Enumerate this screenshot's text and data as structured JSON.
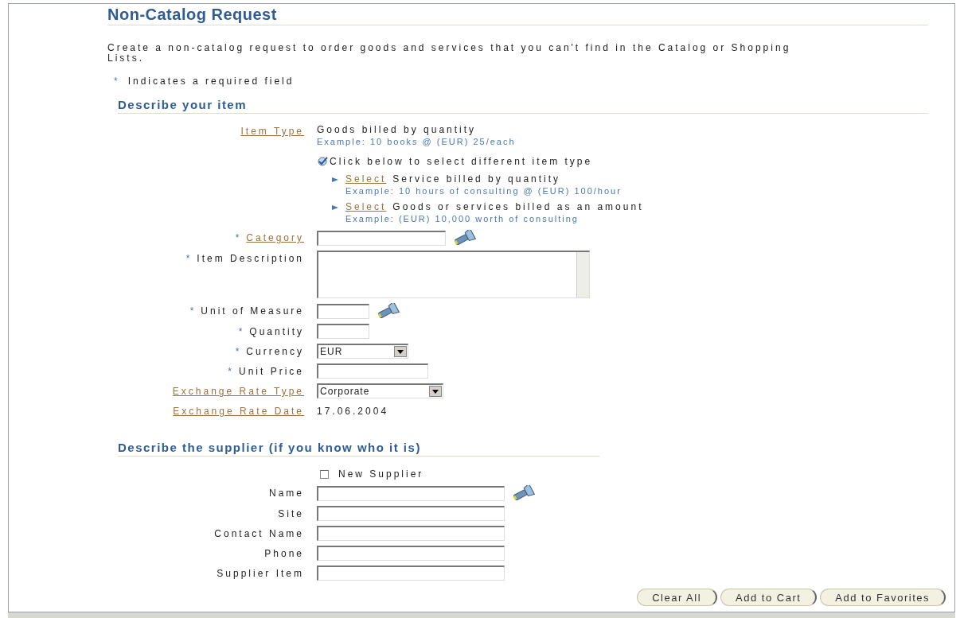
{
  "title": "Non-Catalog Request",
  "intro": "Create a non-catalog request to order goods and services that you can't find in the Catalog or Shopping Lists.",
  "required_note": {
    "mark": "*",
    "text": "Indicates a required field"
  },
  "item_section": {
    "heading": "Describe your item",
    "item_type": {
      "label": "Item Type",
      "value": "Goods billed by quantity",
      "example": "Example: 10 books @ (EUR) 25/each"
    },
    "change_prompt": "Click below to select different item type",
    "options": [
      {
        "link": "Select",
        "text": "Service billed by quantity",
        "example": "Example: 10 hours of consulting @ (EUR) 100/hour"
      },
      {
        "link": "Select",
        "text": "Goods or services billed as an amount",
        "example": "Example: (EUR) 10,000 worth of consulting"
      }
    ],
    "fields": [
      {
        "label": "Category",
        "kind": "lookup",
        "required": true,
        "link": true
      },
      {
        "label": "Item Description",
        "kind": "textarea",
        "required": true,
        "link": false
      },
      {
        "label": "Unit of Measure",
        "kind": "lookup",
        "required": true,
        "link": false
      },
      {
        "label": "Quantity",
        "kind": "text",
        "required": true,
        "link": false
      },
      {
        "label": "Currency",
        "kind": "select",
        "required": true,
        "link": false,
        "value": "EUR"
      },
      {
        "label": "Unit Price",
        "kind": "text",
        "required": true,
        "link": false
      },
      {
        "label": "Exchange Rate Type",
        "kind": "select",
        "required": false,
        "link": true,
        "value": "Corporate"
      },
      {
        "label": "Exchange Rate Date",
        "kind": "static",
        "required": false,
        "link": true,
        "value": "17.06.2004"
      }
    ]
  },
  "supplier_section": {
    "heading": "Describe the supplier (if you know who it is)",
    "new_supplier": {
      "label": "New Supplier",
      "checked": false
    },
    "fields": [
      {
        "label": "Name",
        "kind": "lookup"
      },
      {
        "label": "Site",
        "kind": "text"
      },
      {
        "label": "Contact Name",
        "kind": "text"
      },
      {
        "label": "Phone",
        "kind": "text"
      },
      {
        "label": "Supplier Item",
        "kind": "text"
      }
    ]
  },
  "buttons": [
    "Clear All",
    "Add to Cart",
    "Add to Favorites"
  ]
}
